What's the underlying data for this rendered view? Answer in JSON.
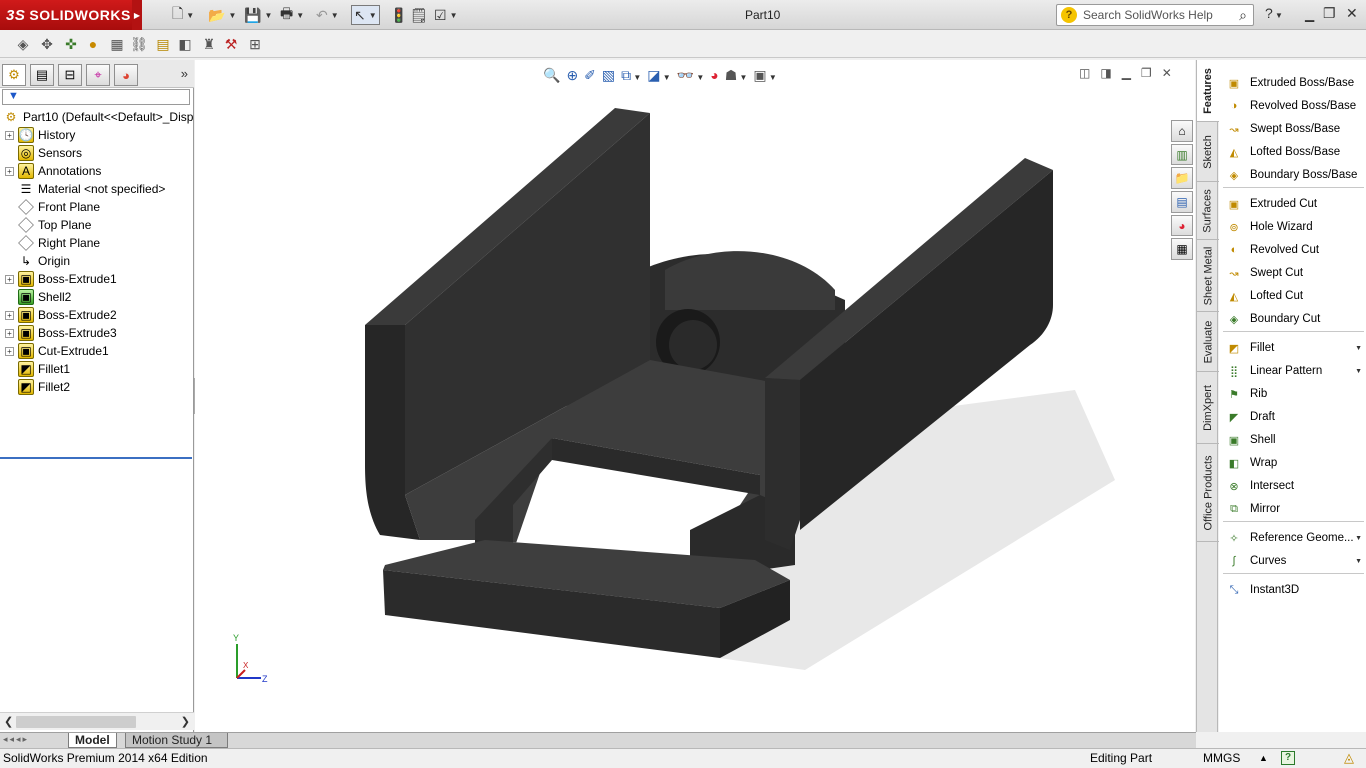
{
  "app": {
    "brand": "SOLIDWORKS",
    "brand_mark": "3S",
    "document_title": "Part10",
    "search_placeholder": "Search SolidWorks Help"
  },
  "feature_tree": {
    "root": "Part10  (Default<<Default>_Disp",
    "items": [
      {
        "label": "History",
        "expandable": true,
        "icon": "history-icon"
      },
      {
        "label": "Sensors",
        "expandable": false,
        "icon": "sensors-icon"
      },
      {
        "label": "Annotations",
        "expandable": true,
        "icon": "annotations-icon"
      },
      {
        "label": "Material <not specified>",
        "expandable": false,
        "icon": "material-icon"
      },
      {
        "label": "Front Plane",
        "expandable": false,
        "icon": "plane-icon"
      },
      {
        "label": "Top Plane",
        "expandable": false,
        "icon": "plane-icon"
      },
      {
        "label": "Right Plane",
        "expandable": false,
        "icon": "plane-icon"
      },
      {
        "label": "Origin",
        "expandable": false,
        "icon": "origin-icon"
      },
      {
        "label": "Boss-Extrude1",
        "expandable": true,
        "icon": "extrude-icon"
      },
      {
        "label": "Shell2",
        "expandable": false,
        "icon": "shell-icon"
      },
      {
        "label": "Boss-Extrude2",
        "expandable": true,
        "icon": "extrude-icon"
      },
      {
        "label": "Boss-Extrude3",
        "expandable": true,
        "icon": "extrude-icon"
      },
      {
        "label": "Cut-Extrude1",
        "expandable": true,
        "icon": "cut-icon"
      },
      {
        "label": "Fillet1",
        "expandable": false,
        "icon": "fillet-icon"
      },
      {
        "label": "Fillet2",
        "expandable": false,
        "icon": "fillet-icon"
      }
    ]
  },
  "command_manager": {
    "tabs": [
      "Features",
      "Sketch",
      "Surfaces",
      "Sheet Metal",
      "Evaluate",
      "DimXpert",
      "Office Products"
    ],
    "active_tab": "Features",
    "items": [
      {
        "label": "Extruded Boss/Base"
      },
      {
        "label": "Revolved Boss/Base"
      },
      {
        "label": "Swept Boss/Base"
      },
      {
        "label": "Lofted Boss/Base"
      },
      {
        "label": "Boundary Boss/Base"
      },
      {
        "label": "Extruded Cut"
      },
      {
        "label": "Hole Wizard"
      },
      {
        "label": "Revolved Cut"
      },
      {
        "label": "Swept Cut"
      },
      {
        "label": "Lofted Cut"
      },
      {
        "label": "Boundary Cut"
      },
      {
        "label": "Fillet"
      },
      {
        "label": "Linear Pattern"
      },
      {
        "label": "Rib"
      },
      {
        "label": "Draft"
      },
      {
        "label": "Shell"
      },
      {
        "label": "Wrap"
      },
      {
        "label": "Intersect"
      },
      {
        "label": "Mirror"
      },
      {
        "label": "Reference Geome..."
      },
      {
        "label": "Curves"
      },
      {
        "label": "Instant3D"
      }
    ]
  },
  "triad": {
    "y": "Y",
    "x": "X",
    "z": "Z"
  },
  "bottom_tabs": [
    "Model",
    "Motion Study 1"
  ],
  "status": {
    "edition": "SolidWorks Premium 2014 x64 Edition",
    "mode": "Editing Part",
    "units": "MMGS"
  },
  "colors": {
    "brand_red": "#c0141a",
    "model_fill": "#333333",
    "selection_blue": "#3b6fc2"
  }
}
